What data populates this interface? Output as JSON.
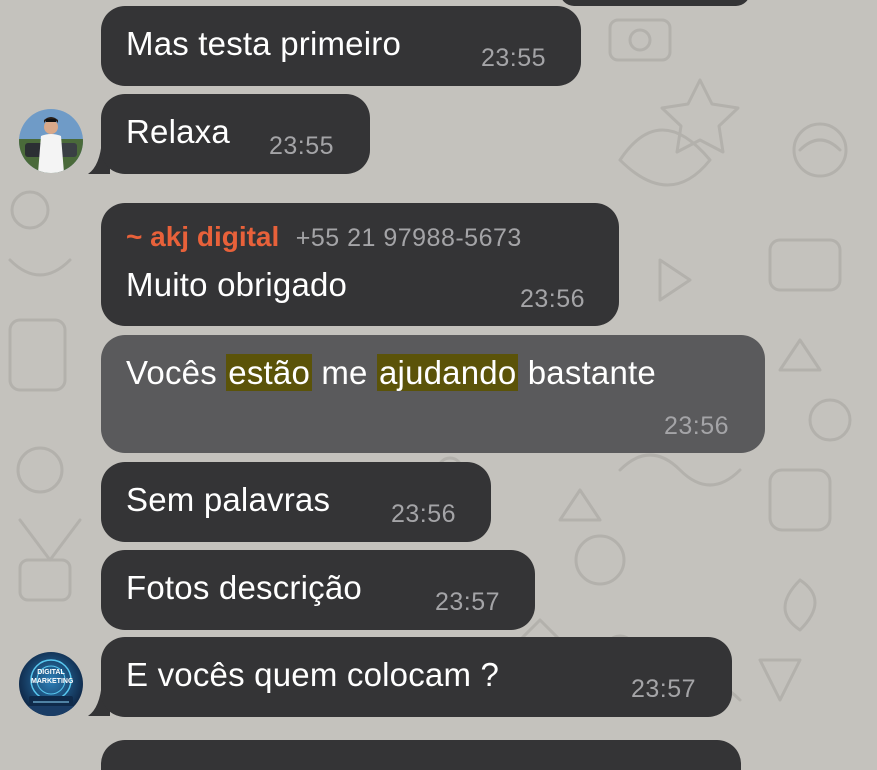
{
  "colors": {
    "background": "#c4c2bd",
    "bubble": "#343436",
    "bubble_highlighted": "#5a5a5c",
    "sender_name": "#e8613a",
    "search_highlight": "#5b5309",
    "timestamp": "#a4a4a7"
  },
  "messages": [
    {
      "text": "Mas testa primeiro",
      "time": "23:55"
    },
    {
      "text": "Relaxa",
      "time": "23:55"
    },
    {
      "sender": "~ akj digital",
      "phone": "+55 21 97988-5673",
      "text": "Muito obrigado",
      "time": "23:56"
    },
    {
      "parts": [
        "Vocês ",
        "estão",
        " me ",
        "ajudando",
        " bastante"
      ],
      "time": "23:56"
    },
    {
      "text": "Sem palavras",
      "time": "23:56"
    },
    {
      "text": "Fotos descrição",
      "time": "23:57"
    },
    {
      "text": "E vocês quem colocam ?",
      "time": "23:57"
    }
  ],
  "avatars": {
    "first": {
      "icon": "person-photo-avatar"
    },
    "second": {
      "icon": "digital-marketing-logo-avatar",
      "text": "DIGITAL MARKETING"
    }
  }
}
